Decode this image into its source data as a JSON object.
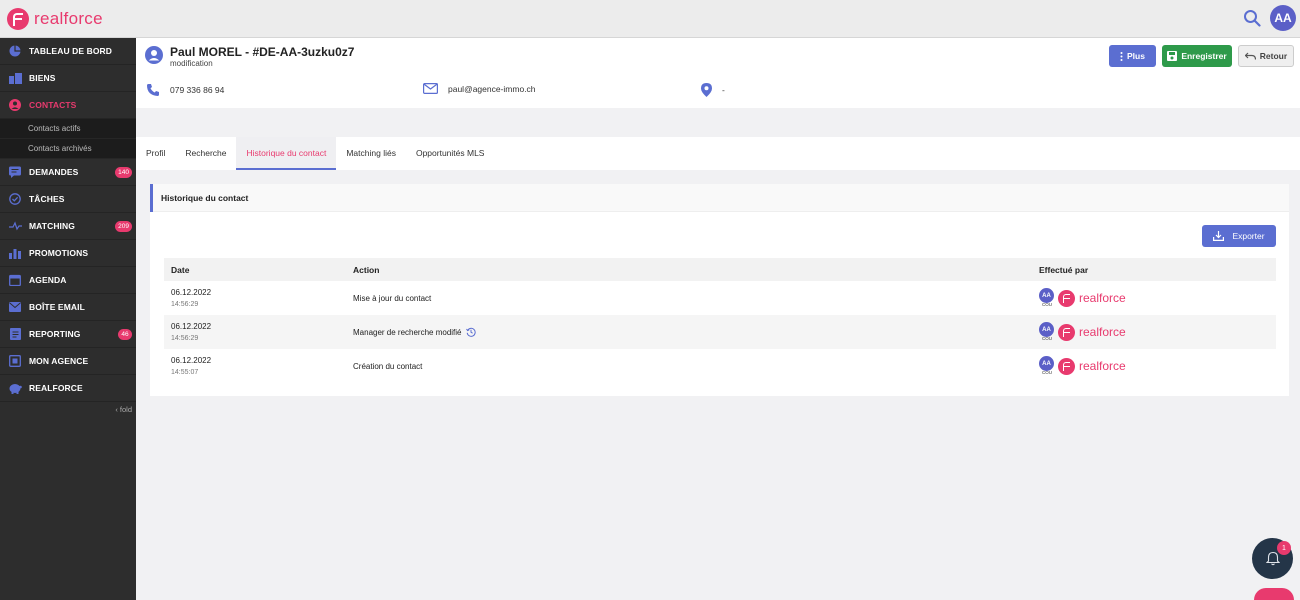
{
  "brand": {
    "name": "realforce",
    "color": "#e83a6e"
  },
  "topbar": {
    "avatar_initials": "AA",
    "search_icon": "search-icon"
  },
  "sidebar": {
    "items": [
      {
        "label": "TABLEAU DE BORD",
        "icon": "dashboard-icon"
      },
      {
        "label": "BIENS",
        "icon": "building-icon"
      },
      {
        "label": "CONTACTS",
        "icon": "contacts-icon",
        "active": true
      },
      {
        "label": "DEMANDES",
        "icon": "message-icon",
        "badge": "140"
      },
      {
        "label": "TÂCHES",
        "icon": "check-circle-icon"
      },
      {
        "label": "MATCHING",
        "icon": "matching-icon",
        "badge": "209"
      },
      {
        "label": "PROMOTIONS",
        "icon": "bar-chart-icon"
      },
      {
        "label": "AGENDA",
        "icon": "calendar-icon"
      },
      {
        "label": "BOÎTE EMAIL",
        "icon": "mail-icon"
      },
      {
        "label": "REPORTING",
        "icon": "report-icon",
        "badge": "46"
      },
      {
        "label": "MON AGENCE",
        "icon": "agency-icon"
      },
      {
        "label": "REALFORCE",
        "icon": "piggy-icon"
      }
    ],
    "sub_items": [
      "Contacts actifs",
      "Contacts archivés"
    ],
    "fold_label": "fold"
  },
  "header": {
    "name": "Paul MOREL - #DE-AA-3uzku0z7",
    "subtitle": "modification",
    "phone": "079 336 86 94",
    "email": "paul@agence-immo.ch",
    "location": "-",
    "buttons": {
      "plus": "Plus",
      "save": "Enregistrer",
      "back": "Retour"
    }
  },
  "tabs": [
    "Profil",
    "Recherche",
    "Historique du contact",
    "Matching liés",
    "Opportunités MLS"
  ],
  "card": {
    "title": "Historique du contact",
    "export_label": "Exporter",
    "columns": {
      "date": "Date",
      "action": "Action",
      "by": "Effectué par"
    },
    "rows": [
      {
        "date": "06.12.2022",
        "time": "14:56:29",
        "action": "Mise à jour du contact",
        "initials": "AA",
        "tag": "COU",
        "company": "realforce"
      },
      {
        "date": "06.12.2022",
        "time": "14:56:29",
        "action": "Manager de recherche modifié",
        "has_history_icon": true,
        "initials": "AA",
        "tag": "COU",
        "company": "realforce"
      },
      {
        "date": "06.12.2022",
        "time": "14:55:07",
        "action": "Création du contact",
        "initials": "AA",
        "tag": "COU",
        "company": "realforce"
      }
    ]
  },
  "notifications": {
    "count": "1"
  }
}
